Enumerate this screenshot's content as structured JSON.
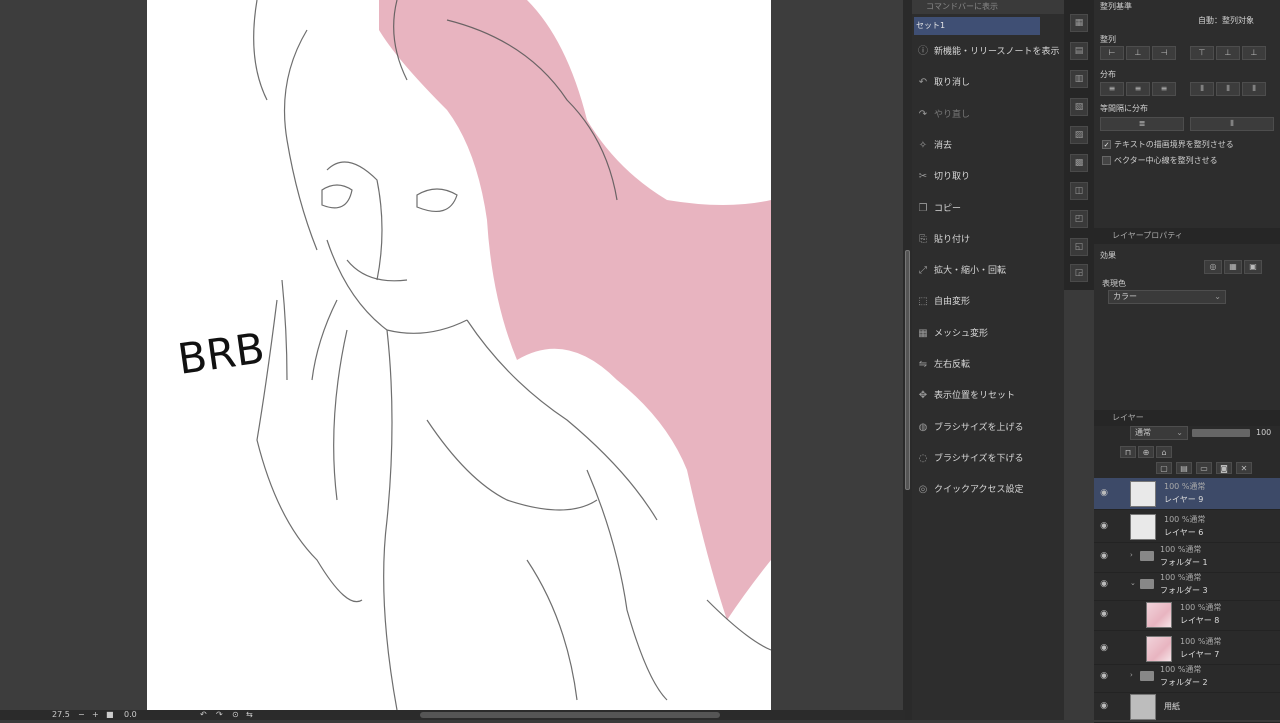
{
  "status": {
    "zoom": "27.5",
    "angle": "0.0"
  },
  "canvas": {
    "handwritten_text": "BRB"
  },
  "command_panel": {
    "title": "コマンドバーに表示",
    "set_tab": "セット1",
    "items": [
      {
        "icon": "info-icon",
        "label": "新機能・リリースノートを表示",
        "enabled": true
      },
      {
        "icon": "undo-icon",
        "label": "取り消し",
        "enabled": true
      },
      {
        "icon": "redo-icon",
        "label": "やり直し",
        "enabled": false
      },
      {
        "icon": "erase-icon",
        "label": "消去",
        "enabled": true
      },
      {
        "icon": "cut-icon",
        "label": "切り取り",
        "enabled": true
      },
      {
        "icon": "copy-icon",
        "label": "コピー",
        "enabled": true
      },
      {
        "icon": "paste-icon",
        "label": "貼り付け",
        "enabled": true
      },
      {
        "icon": "transform-icon",
        "label": "拡大・縮小・回転",
        "enabled": true
      },
      {
        "icon": "free-transform-icon",
        "label": "自由変形",
        "enabled": true
      },
      {
        "icon": "mesh-icon",
        "label": "メッシュ変形",
        "enabled": true
      },
      {
        "icon": "flip-icon",
        "label": "左右反転",
        "enabled": true
      },
      {
        "icon": "reset-view-icon",
        "label": "表示位置をリセット",
        "enabled": true
      },
      {
        "icon": "brush-up-icon",
        "label": "ブラシサイズを上げる",
        "enabled": true
      },
      {
        "icon": "brush-down-icon",
        "label": "ブラシサイズを下げる",
        "enabled": true
      },
      {
        "icon": "quick-access-icon",
        "label": "クイックアクセス設定",
        "enabled": true
      }
    ]
  },
  "align_panel": {
    "header": "整列基準",
    "target": "自動：整列対象",
    "align_label": "整列",
    "distribute_label": "分布",
    "equal_spacing_label": "等間隔に分布",
    "option_text_bounds": "テキストの描画境界を整列させる",
    "option_text_bounds_checked": true,
    "option_vector_center": "ベクター中心線を整列させる",
    "option_vector_center_checked": false
  },
  "layer_property": {
    "title": "レイヤープロパティ",
    "effect_label": "効果",
    "expression_color_label": "表現色",
    "expression_color_value": "カラー"
  },
  "layer_panel": {
    "title": "レイヤー",
    "blend_mode": "通常",
    "opacity": "100",
    "layers": [
      {
        "mode": "100 %通常",
        "name": "レイヤー 9",
        "type": "layer",
        "selected": true,
        "indent": 0
      },
      {
        "mode": "100 %通常",
        "name": "レイヤー 6",
        "type": "layer",
        "selected": false,
        "indent": 0
      },
      {
        "mode": "100 %通常",
        "name": "フォルダー 1",
        "type": "folder",
        "selected": false,
        "indent": 0,
        "expanded": false
      },
      {
        "mode": "100 %通常",
        "name": "フォルダー 3",
        "type": "folder",
        "selected": false,
        "indent": 0,
        "expanded": true
      },
      {
        "mode": "100 %通常",
        "name": "レイヤー 8",
        "type": "layer",
        "selected": false,
        "indent": 1
      },
      {
        "mode": "100 %通常",
        "name": "レイヤー 7",
        "type": "layer",
        "selected": false,
        "indent": 1
      },
      {
        "mode": "100 %通常",
        "name": "フォルダー 2",
        "type": "folder",
        "selected": false,
        "indent": 0,
        "expanded": false
      },
      {
        "mode": "",
        "name": "用紙",
        "type": "paper",
        "selected": false,
        "indent": 0
      }
    ]
  },
  "colors": {
    "hair": "#e8b4c0",
    "panel_bg": "#2d2d2d",
    "selected_row": "#3d4a68"
  }
}
